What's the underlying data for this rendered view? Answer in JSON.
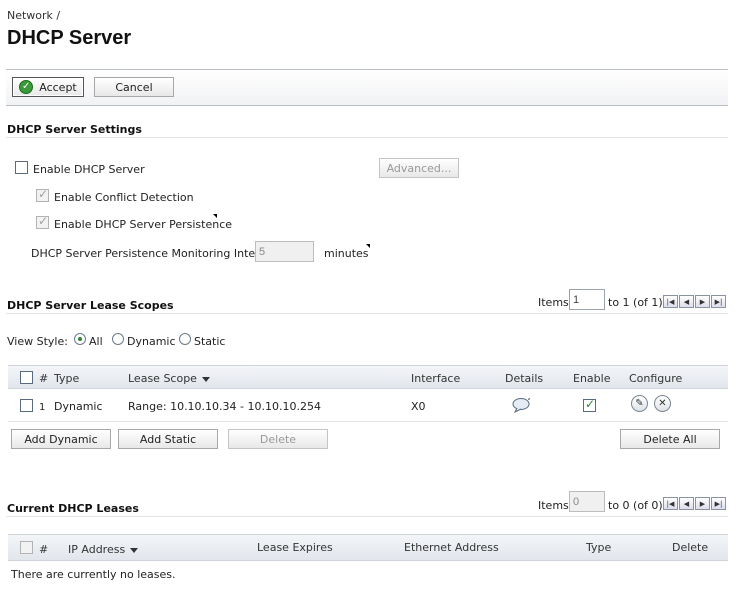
{
  "breadcrumb": "Network /",
  "page_title": "DHCP Server",
  "toolbar": {
    "accept_label": "Accept",
    "cancel_label": "Cancel"
  },
  "settings": {
    "title": "DHCP Server Settings",
    "enable_dhcp_label": "Enable DHCP Server",
    "enable_dhcp_checked": false,
    "advanced_label": "Advanced...",
    "conflict_label": "Enable Conflict Detection",
    "conflict_checked": true,
    "persistence_label": "Enable DHCP Server Persistence",
    "persistence_checked": true,
    "interval_label": "DHCP Server Persistence Monitoring Interval:",
    "interval_value": "5",
    "interval_unit": "minutes"
  },
  "scopes": {
    "title": "DHCP Server Lease Scopes",
    "items_label": "Items",
    "items_value": "1",
    "items_range": "to 1 (of 1)",
    "view_style_label": "View Style:",
    "view_options": [
      "All",
      "Dynamic",
      "Static"
    ],
    "view_selected": "All",
    "columns": [
      "#",
      "Type",
      "Lease Scope",
      "Interface",
      "Details",
      "Enable",
      "Configure"
    ],
    "rows": [
      {
        "num": "1",
        "type": "Dynamic",
        "scope": "Range: 10.10.10.34 - 10.10.10.254",
        "interface": "X0",
        "enabled": true
      }
    ],
    "add_dynamic_label": "Add Dynamic",
    "add_static_label": "Add Static",
    "delete_label": "Delete",
    "delete_all_label": "Delete All"
  },
  "leases": {
    "title": "Current DHCP Leases",
    "items_label": "Items",
    "items_value": "0",
    "items_range": "to 0 (of 0)",
    "columns": [
      "#",
      "IP Address",
      "Lease Expires",
      "Ethernet Address",
      "Type",
      "Delete"
    ],
    "empty_text": "There are currently no leases."
  }
}
